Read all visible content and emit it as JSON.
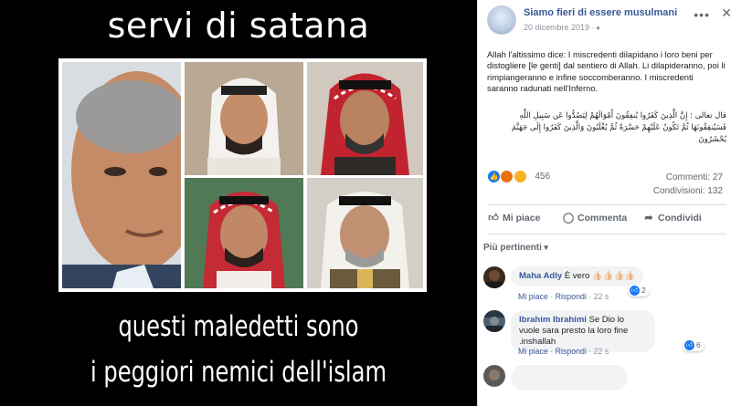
{
  "meme": {
    "top_caption": "servi di satana",
    "bottom_caption_line1": "questi maledetti sono",
    "bottom_caption_line2": "i peggiori nemici dell'islam"
  },
  "post": {
    "page_name": "Siamo fieri di essere musulmani",
    "date": "20 dicembre 2019",
    "text_it": "Allah l'altissimo dice: I miscredenti dilapidano i loro beni per distogliere [le genti] dal sentiero di Allah. Li dilapideranno, poi li rimpiangeranno e infine soccomberanno. I miscredenti saranno radunati nell'Inferno.",
    "text_ar": "قال تعالى : إِنَّ الَّذِينَ كَفَرُوا يُنفِقُونَ أَمْوَالَهُمْ لِيَصُدُّوا عَن سَبِيلِ اللَّهِ فَسَيُنفِقُونَهَا ثُمَّ تَكُونُ عَلَيْهِمْ حَسْرَةً ثُمَّ يُغْلَبُونَ وَالَّذِينَ كَفَرُوا إِلَى جَهَنَّمَ يُحْشَرُونَ",
    "reactions_count": "456",
    "comments_stat": "Commenti: 27",
    "shares_stat": "Condivisioni: 132",
    "actions": {
      "like": "Mi piace",
      "comment": "Commenta",
      "share": "Condividi"
    },
    "sort_label": "Più pertinenti",
    "comments": [
      {
        "author": "Maha Adly",
        "text": "È vero 👍🏻👍🏻👍🏻👍🏻",
        "like_label": "Mi piace",
        "reply_label": "Rispondi",
        "time": "22 s",
        "likes": "2"
      },
      {
        "author": "Ibrahim Ibrahimi",
        "text": "Se Dio lo vuole sara presto la loro fine .inshallah",
        "like_label": "Mi piace",
        "reply_label": "Rispondi",
        "time": "22 s",
        "likes": "6"
      }
    ]
  },
  "colors": {
    "link_blue": "#385898",
    "fb_blue": "#1877f2",
    "meta_gray": "#90949c"
  },
  "icons": [
    "more-icon",
    "close-icon",
    "like-icon",
    "comment-icon",
    "share-icon",
    "like-reaction-icon",
    "angry-reaction-icon",
    "sad-reaction-icon"
  ]
}
